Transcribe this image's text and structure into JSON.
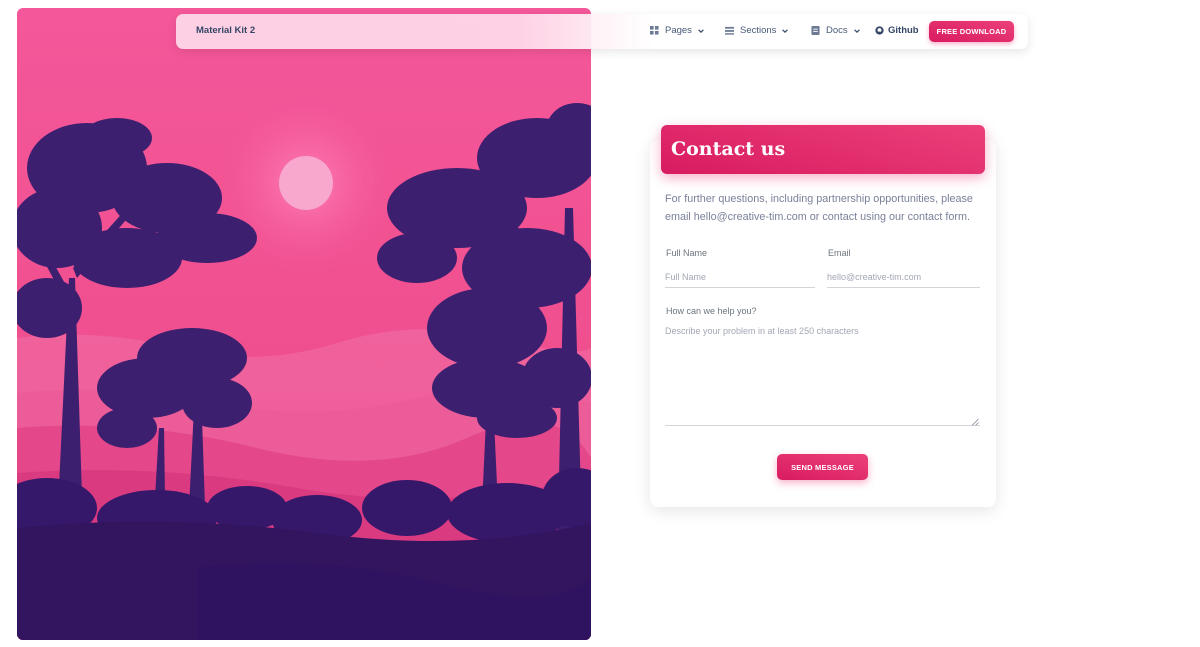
{
  "navbar": {
    "brand": "Material Kit 2",
    "items": [
      {
        "label": "Pages",
        "icon": "grid-icon"
      },
      {
        "label": "Sections",
        "icon": "list-icon"
      },
      {
        "label": "Docs",
        "icon": "doc-icon"
      }
    ],
    "github_label": "Github",
    "download_label": "FREE DOWNLOAD"
  },
  "hero": {
    "description": "illustration",
    "colors": {
      "sky_top": "#f25393",
      "sky_bottom": "#e74283",
      "tree": "#3b1d6e",
      "ground": "#32145f",
      "sun": "#f7a8cc"
    }
  },
  "contact": {
    "title": "Contact us",
    "intro": "For further questions, including partnership opportunities, please email hello@creative-tim.com or contact using our contact form.",
    "full_name_label": "Full Name",
    "full_name_placeholder": "Full Name",
    "full_name_value": "",
    "email_label": "Email",
    "email_placeholder": "hello@creative-tim.com",
    "email_value": "",
    "message_label": "How can we help you?",
    "message_placeholder": "Describe your problem in at least 250 characters",
    "message_value": "",
    "send_label": "SEND MESSAGE"
  },
  "theme": {
    "accent": "#e91e63",
    "text": "#344767",
    "muted": "#7b809a"
  }
}
